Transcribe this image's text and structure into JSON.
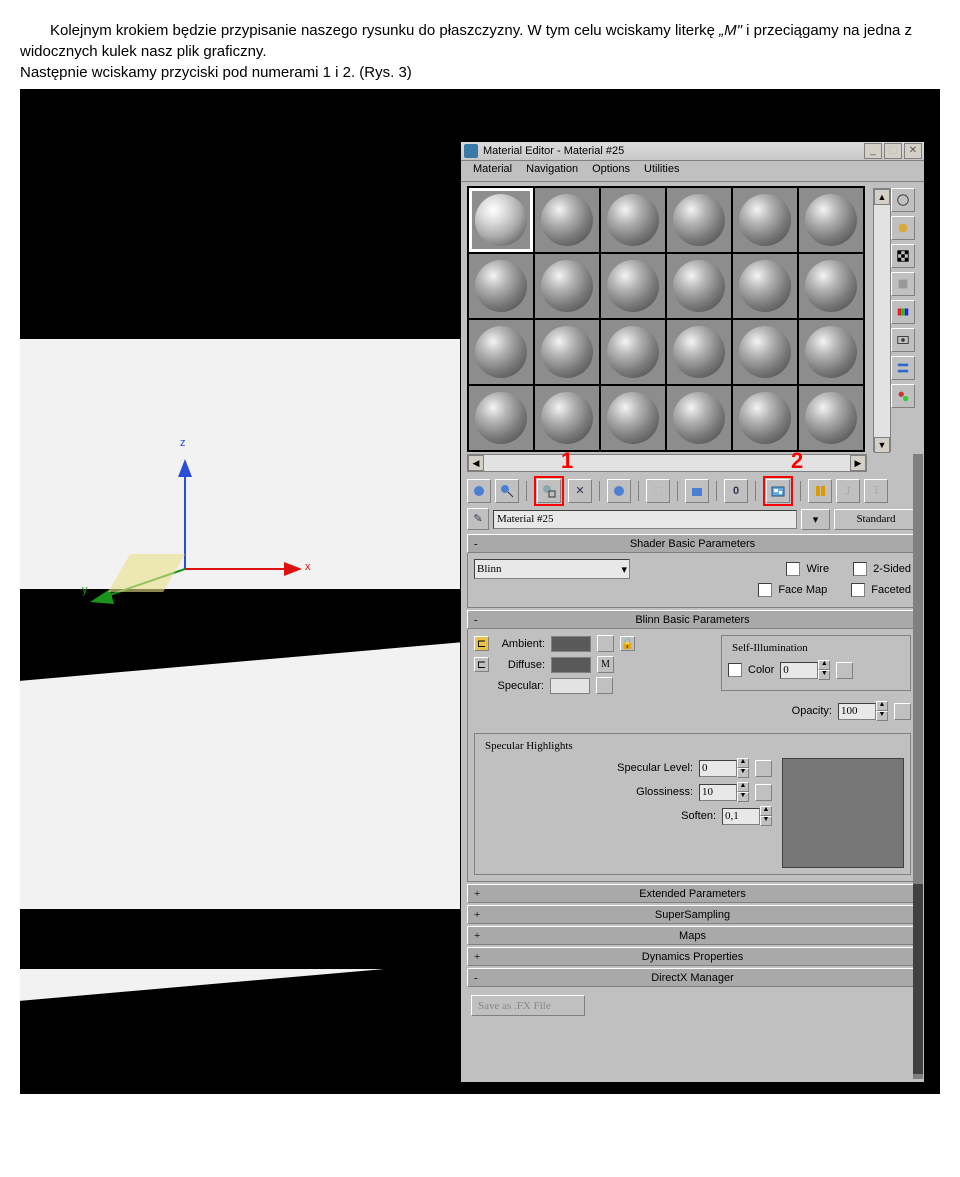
{
  "intro": {
    "p1_a": "Kolejnym krokiem będzie przypisanie naszego rysunku do płaszczyzny. W tym celu wciskamy literkę ",
    "p1_em": "„M\"",
    "p1_b": " i przeciągamy na jedna z widocznych kulek nasz plik graficzny.",
    "p2": "Następnie wciskamy przyciski pod numerami 1 i 2. (Rys. 3)"
  },
  "window": {
    "title": "Material Editor - Material #25",
    "menus": [
      "Material",
      "Navigation",
      "Options",
      "Utilities"
    ]
  },
  "annot": {
    "one": "1",
    "two": "2"
  },
  "namebar": {
    "pick_tip": "✎",
    "name": "Material #25",
    "type": "Standard"
  },
  "rollups": {
    "sbp": {
      "title": "Shader Basic Parameters",
      "shader": "Blinn",
      "wire": "Wire",
      "twosided": "2-Sided",
      "facemap": "Face Map",
      "faceted": "Faceted"
    },
    "bbp": {
      "title": "Blinn Basic Parameters",
      "self": "Self-Illumination",
      "ambient": "Ambient:",
      "diffuse": "Diffuse:",
      "specular": "Specular:",
      "color": "Color",
      "colorval": "0",
      "opacity": "Opacity:",
      "opval": "100",
      "m": "M",
      "highlights": "Specular Highlights",
      "speclvl": "Specular Level:",
      "speclvl_v": "0",
      "gloss": "Glossiness:",
      "gloss_v": "10",
      "soften": "Soften:",
      "soften_v": "0,1"
    },
    "closed": [
      {
        "pm": "+",
        "t": "Extended Parameters"
      },
      {
        "pm": "+",
        "t": "SuperSampling"
      },
      {
        "pm": "+",
        "t": "Maps"
      },
      {
        "pm": "+",
        "t": "Dynamics Properties"
      },
      {
        "pm": "-",
        "t": "DirectX Manager"
      }
    ],
    "fxbtn": "Save as .FX File"
  },
  "axes": {
    "x": "x",
    "y": "y",
    "z": "z"
  }
}
